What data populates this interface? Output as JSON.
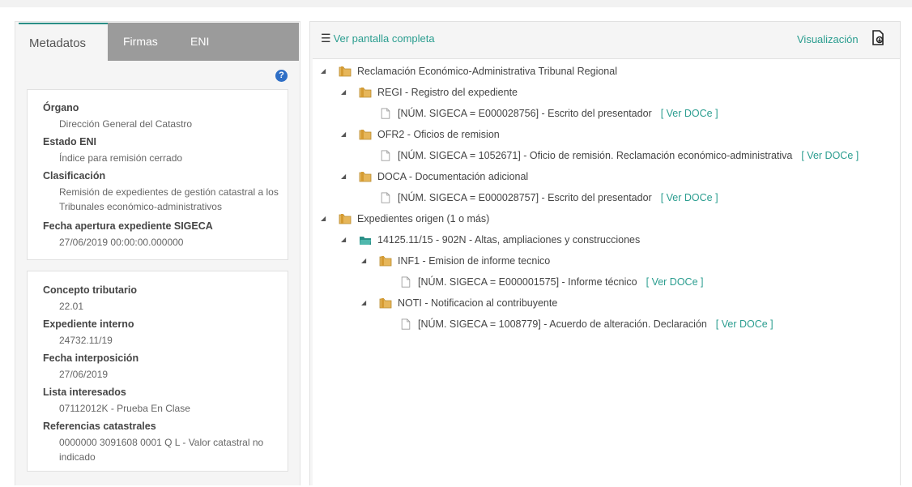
{
  "tabs": [
    "Metadatos",
    "Firmas",
    "ENI"
  ],
  "help_icon": "?",
  "box1": [
    {
      "label": "Órgano",
      "value": "Dirección General del Catastro"
    },
    {
      "label": "Estado ENI",
      "value": "Índice para remisión cerrado"
    },
    {
      "label": "Clasificación",
      "value": "Remisión de expedientes de gestión catastral a los Tribunales económico-administrativos"
    },
    {
      "label": "Fecha apertura expediente SIGECA",
      "value": "27/06/2019 00:00:00.000000"
    }
  ],
  "box2": [
    {
      "label": "Concepto tributario",
      "value": "22.01"
    },
    {
      "label": "Expediente interno",
      "value": "24732.11/19"
    },
    {
      "label": "Fecha interposición",
      "value": "27/06/2019"
    },
    {
      "label": "Lista interesados",
      "value": "07112012K - Prueba En Clase"
    },
    {
      "label": "Referencias catastrales",
      "value": "0000000 3091608 0001 Q L - Valor catastral no indicado"
    }
  ],
  "header": {
    "fullscreen_label": "Ver pantalla completa",
    "visualizacion_label": "Visualización"
  },
  "tree": [
    {
      "type": "folder",
      "text": "Reclamación Económico-Administrativa Tribunal Regional"
    },
    {
      "type": "folder",
      "text": "REGI - Registro del expediente"
    },
    {
      "type": "doc",
      "text": "[NÚM. SIGECA = E000028756] - Escrito del presentador",
      "link": "[ Ver DOCe ]"
    },
    {
      "type": "folder",
      "text": "OFR2 - Oficios de remision"
    },
    {
      "type": "doc",
      "text": "[NÚM. SIGECA = 1052671] - Oficio de remisión. Reclamación económico-administrativa",
      "link": "[ Ver DOCe ]"
    },
    {
      "type": "folder",
      "text": "DOCA - Documentación adicional"
    },
    {
      "type": "doc",
      "text": "[NÚM. SIGECA = E000028757] - Escrito del presentador",
      "link": "[ Ver DOCe ]"
    },
    {
      "type": "folder",
      "text": "Expedientes origen  (1 o más)"
    },
    {
      "type": "openfolder",
      "text": "14125.11/15 - 902N - Altas, ampliaciones y construcciones"
    },
    {
      "type": "folder",
      "text": "INF1 - Emision de informe tecnico"
    },
    {
      "type": "doc",
      "text": "[NÚM. SIGECA = E000001575] - Informe técnico",
      "link": "[ Ver DOCe ]"
    },
    {
      "type": "folder",
      "text": "NOTI - Notificacion al contribuyente"
    },
    {
      "type": "doc",
      "text": "[NÚM. SIGECA = 1008779] - Acuerdo de alteración. Declaración",
      "link": "[ Ver DOCe ]"
    }
  ],
  "colors": {
    "accent": "#2a9d8f",
    "folder": "#d9a441",
    "tabs_bg": "#9b9b9b",
    "help": "#2f6fc6"
  }
}
